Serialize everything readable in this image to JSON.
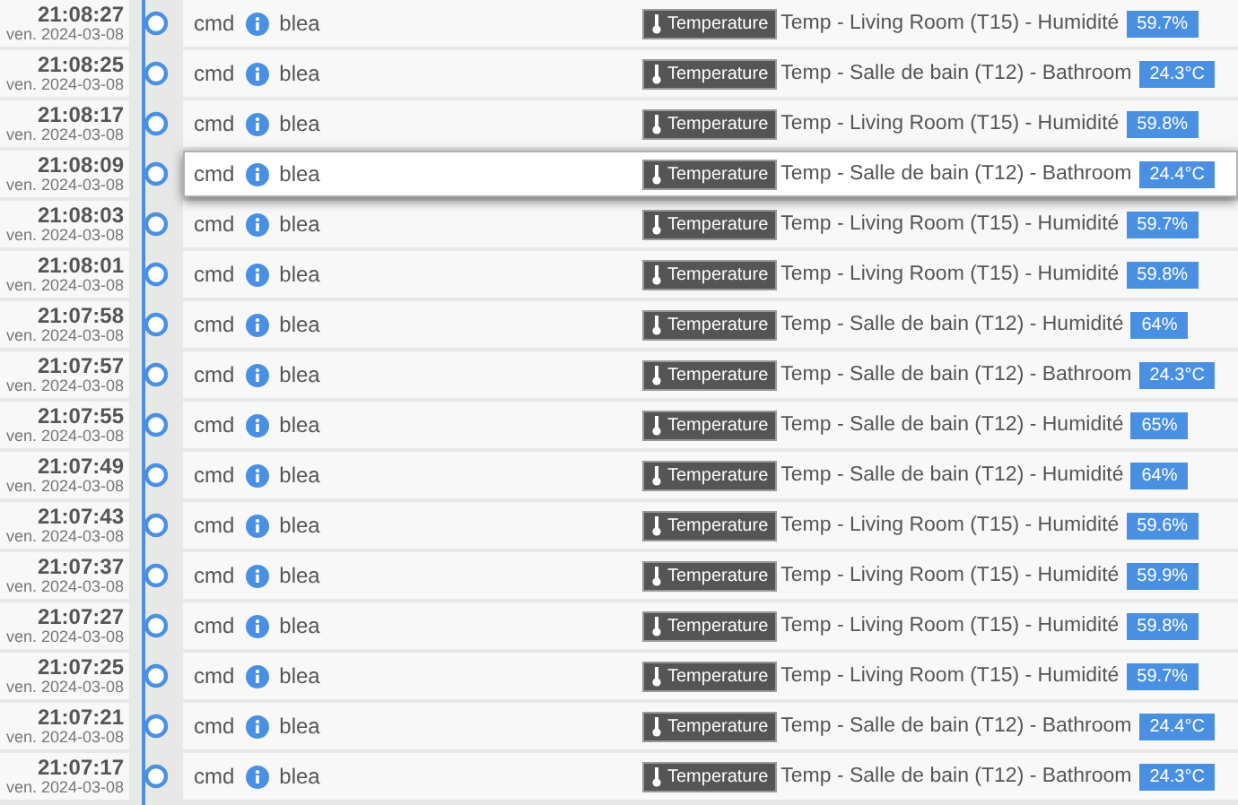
{
  "events": [
    {
      "time": "21:08:27",
      "date": "ven. 2024-03-08",
      "type": "cmd",
      "source": "blea",
      "tag": "Temperature",
      "name": "Temp - Living Room (T15) - Humidité",
      "value": "59.7%",
      "highlighted": false
    },
    {
      "time": "21:08:25",
      "date": "ven. 2024-03-08",
      "type": "cmd",
      "source": "blea",
      "tag": "Temperature",
      "name": "Temp - Salle de bain (T12) - Bathroom",
      "value": "24.3°C",
      "highlighted": false
    },
    {
      "time": "21:08:17",
      "date": "ven. 2024-03-08",
      "type": "cmd",
      "source": "blea",
      "tag": "Temperature",
      "name": "Temp - Living Room (T15) - Humidité",
      "value": "59.8%",
      "highlighted": false
    },
    {
      "time": "21:08:09",
      "date": "ven. 2024-03-08",
      "type": "cmd",
      "source": "blea",
      "tag": "Temperature",
      "name": "Temp - Salle de bain (T12) - Bathroom",
      "value": "24.4°C",
      "highlighted": true
    },
    {
      "time": "21:08:03",
      "date": "ven. 2024-03-08",
      "type": "cmd",
      "source": "blea",
      "tag": "Temperature",
      "name": "Temp - Living Room (T15) - Humidité",
      "value": "59.7%",
      "highlighted": false
    },
    {
      "time": "21:08:01",
      "date": "ven. 2024-03-08",
      "type": "cmd",
      "source": "blea",
      "tag": "Temperature",
      "name": "Temp - Living Room (T15) - Humidité",
      "value": "59.8%",
      "highlighted": false
    },
    {
      "time": "21:07:58",
      "date": "ven. 2024-03-08",
      "type": "cmd",
      "source": "blea",
      "tag": "Temperature",
      "name": "Temp - Salle de bain (T12) - Humidité",
      "value": "64%",
      "highlighted": false
    },
    {
      "time": "21:07:57",
      "date": "ven. 2024-03-08",
      "type": "cmd",
      "source": "blea",
      "tag": "Temperature",
      "name": "Temp - Salle de bain (T12) - Bathroom",
      "value": "24.3°C",
      "highlighted": false
    },
    {
      "time": "21:07:55",
      "date": "ven. 2024-03-08",
      "type": "cmd",
      "source": "blea",
      "tag": "Temperature",
      "name": "Temp - Salle de bain (T12) - Humidité",
      "value": "65%",
      "highlighted": false
    },
    {
      "time": "21:07:49",
      "date": "ven. 2024-03-08",
      "type": "cmd",
      "source": "blea",
      "tag": "Temperature",
      "name": "Temp - Salle de bain (T12) - Humidité",
      "value": "64%",
      "highlighted": false
    },
    {
      "time": "21:07:43",
      "date": "ven. 2024-03-08",
      "type": "cmd",
      "source": "blea",
      "tag": "Temperature",
      "name": "Temp - Living Room (T15) - Humidité",
      "value": "59.6%",
      "highlighted": false
    },
    {
      "time": "21:07:37",
      "date": "ven. 2024-03-08",
      "type": "cmd",
      "source": "blea",
      "tag": "Temperature",
      "name": "Temp - Living Room (T15) - Humidité",
      "value": "59.9%",
      "highlighted": false
    },
    {
      "time": "21:07:27",
      "date": "ven. 2024-03-08",
      "type": "cmd",
      "source": "blea",
      "tag": "Temperature",
      "name": "Temp - Living Room (T15) - Humidité",
      "value": "59.8%",
      "highlighted": false
    },
    {
      "time": "21:07:25",
      "date": "ven. 2024-03-08",
      "type": "cmd",
      "source": "blea",
      "tag": "Temperature",
      "name": "Temp - Living Room (T15) - Humidité",
      "value": "59.7%",
      "highlighted": false
    },
    {
      "time": "21:07:21",
      "date": "ven. 2024-03-08",
      "type": "cmd",
      "source": "blea",
      "tag": "Temperature",
      "name": "Temp - Salle de bain (T12) - Bathroom",
      "value": "24.4°C",
      "highlighted": false
    },
    {
      "time": "21:07:17",
      "date": "ven. 2024-03-08",
      "type": "cmd",
      "source": "blea",
      "tag": "Temperature",
      "name": "Temp - Salle de bain (T12) - Bathroom",
      "value": "24.3°C",
      "highlighted": false
    }
  ]
}
